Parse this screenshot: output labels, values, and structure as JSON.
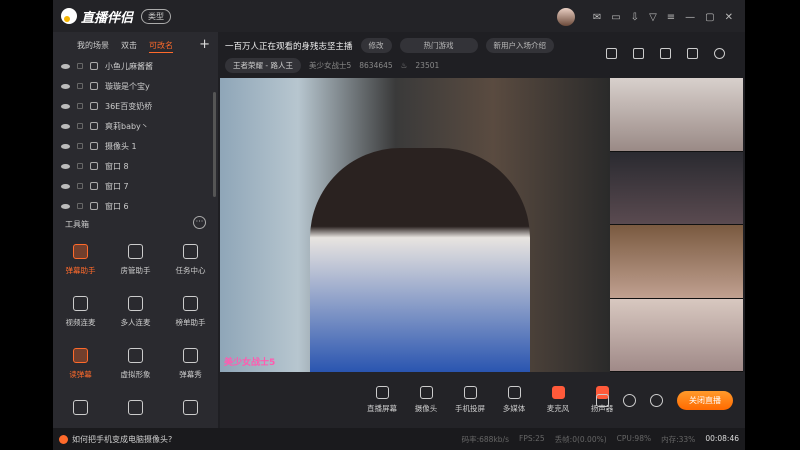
{
  "app": {
    "name": "直播伴侣",
    "type_button": "类型"
  },
  "sidebar": {
    "tabs": [
      "我的场景",
      "双击",
      "可改名"
    ],
    "active_tab": 2,
    "sources": [
      {
        "label": "小鱼儿麻酱酱",
        "icon": "link-icon"
      },
      {
        "label": "璇璇是个宝y",
        "icon": "link-icon"
      },
      {
        "label": "36E百变奶桥",
        "icon": "link-icon"
      },
      {
        "label": "爽莉baby丶",
        "icon": "link-icon"
      },
      {
        "label": "摄像头 1",
        "icon": "camera-icon"
      },
      {
        "label": "窗口 8",
        "icon": "window-icon"
      },
      {
        "label": "窗口 7",
        "icon": "window-icon"
      },
      {
        "label": "窗口 6",
        "icon": "window-icon"
      }
    ],
    "toolbox_title": "工具箱",
    "tools": [
      {
        "label": "弹幕助手",
        "active": true
      },
      {
        "label": "房管助手"
      },
      {
        "label": "任务中心"
      },
      {
        "label": "视频连麦"
      },
      {
        "label": "多人连麦"
      },
      {
        "label": "榜单助手"
      },
      {
        "label": "读弹幕",
        "active": true
      },
      {
        "label": "虚拟形象"
      },
      {
        "label": "弹幕秀"
      },
      {
        "label": ""
      },
      {
        "label": ""
      },
      {
        "label": ""
      }
    ]
  },
  "header": {
    "title": "一百万人正在观看的身残志坚主播",
    "edit": "修改",
    "category": "热门游戏",
    "intro": "新用户入场介绍",
    "game": "王者荣耀 - 路人王",
    "nickname": "美少女战士5",
    "id": "8634645",
    "heat": "23501"
  },
  "video": {
    "label": "美少女战士5"
  },
  "controls": [
    "直播屏幕",
    "摄像头",
    "手机投屏",
    "多媒体",
    "麦克风",
    "扬声器"
  ],
  "stop_live": "关闭直播",
  "tip": "如何把手机变成电脑摄像头?",
  "stats": {
    "bitrate": "码率:688kb/s",
    "fps": "FPS:25",
    "drop": "丢帧:0(0.00%)",
    "cpu": "CPU:98%",
    "mem": "内存:33%",
    "time": "00:08:46"
  },
  "colors": {
    "accent": "#ff6a2b"
  }
}
